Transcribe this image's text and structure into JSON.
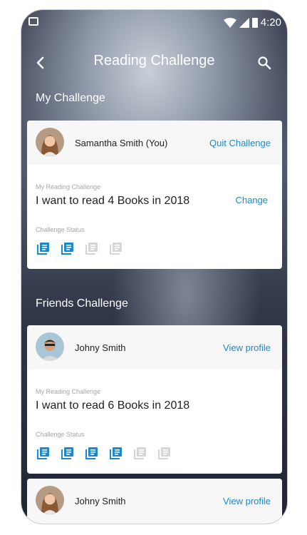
{
  "status_bar": {
    "time": "4:20"
  },
  "app_bar": {
    "title": "Reading Challenge"
  },
  "my_challenge": {
    "section_title": "My Challenge",
    "user_name": "Samantha Smith (You)",
    "action_label": "Quit Challenge",
    "goal_caption": "My Reading Challenge",
    "goal_text": "I want to read 4 Books in 2018",
    "change_label": "Change",
    "status_caption": "Challenge Status",
    "books_total": 4,
    "books_completed": 2
  },
  "friends_challenge": {
    "section_title": "Friends Challenge",
    "friends": [
      {
        "name": "Johny Smith",
        "action_label": "View profile",
        "goal_caption": "My Reading Challenge",
        "goal_text": "I want to read 6 Books in 2018",
        "status_caption": "Challenge Status",
        "books_total": 6,
        "books_completed": 4
      },
      {
        "name": "Johny Smith",
        "action_label": "View profile"
      }
    ]
  },
  "colors": {
    "accent": "#1e88c8",
    "book_done": "#1e88c8",
    "book_pending": "#d6d6d6"
  }
}
